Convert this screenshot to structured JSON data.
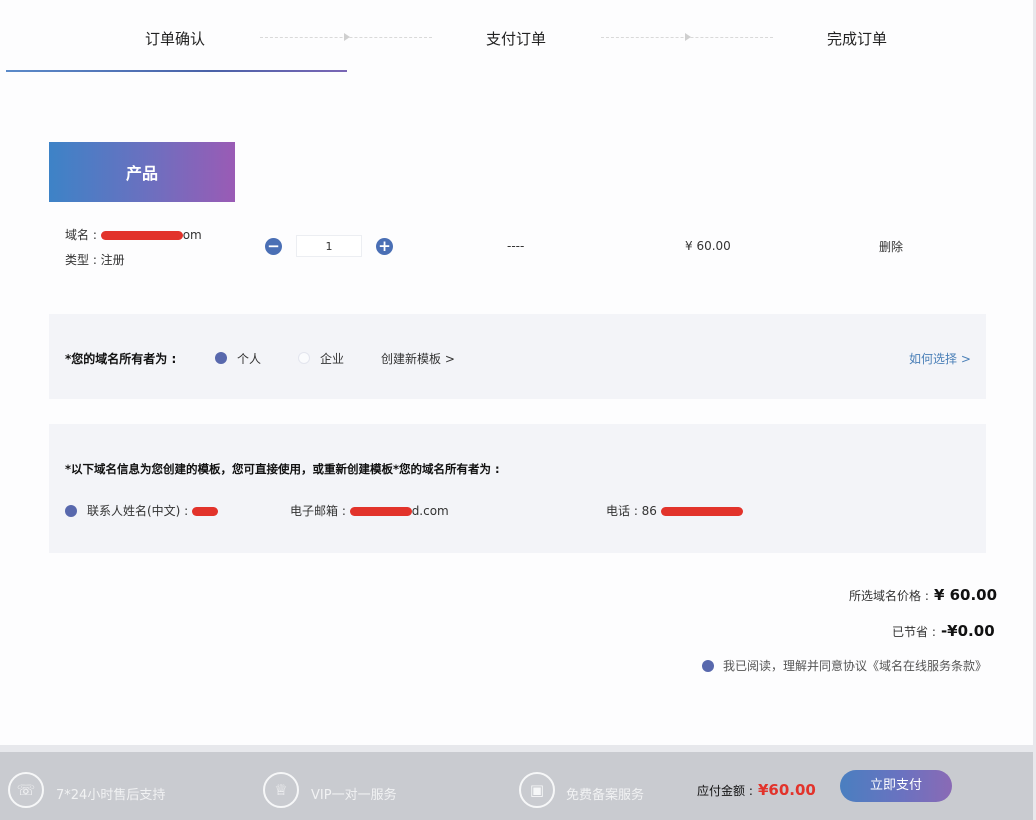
{
  "steps": [
    {
      "label": "订单确认",
      "active": true
    },
    {
      "label": "支付订单",
      "active": false
    },
    {
      "label": "完成订单",
      "active": false
    }
  ],
  "product": {
    "tab_label": "产品",
    "domain_label": "域名 :",
    "domain_visible_suffix": "om",
    "type_label": "类型 : 注册",
    "quantity": "1",
    "decrease_symbol": "−",
    "increase_symbol": "+",
    "years": "----",
    "price": "¥ 60.00",
    "delete_label": "删除"
  },
  "owner": {
    "label": "*您的域名所有者为 :",
    "options": [
      {
        "label": "个人",
        "selected": true
      },
      {
        "label": "企业",
        "selected": false
      }
    ],
    "create_template": "创建新模板 >",
    "how_to_choose": "如何选择 >"
  },
  "template_info": {
    "title": "*以下域名信息为您创建的模板，您可直接使用，或重新创建模板*您的域名所有者为 :",
    "contact_label": "联系人姓名(中文) :",
    "email_label": "电子邮箱 :",
    "email_visible_suffix": "d.com",
    "phone_label": "电话 : 86"
  },
  "summary": {
    "price_label": "所选域名价格 :",
    "price_value": "¥ 60.00",
    "saved_label": "已节省 :",
    "saved_value": "-¥0.00",
    "agreement": "我已阅读，理解并同意协议《域名在线服务条款》"
  },
  "footer": {
    "features": [
      {
        "icon": "headset-icon",
        "label": "7*24小时售后支持"
      },
      {
        "icon": "crown-icon",
        "label": "VIP一对一服务"
      },
      {
        "icon": "certificate-icon",
        "label": "免费备案服务"
      }
    ],
    "amount_label": "应付金额 :",
    "amount_value": "¥60.00",
    "pay_button": "立即支付"
  },
  "colors": {
    "accent": "#4a6fb5",
    "gradient_start": "#3d83c7",
    "gradient_end": "#9a5bb5",
    "price_red": "#e2332b"
  }
}
